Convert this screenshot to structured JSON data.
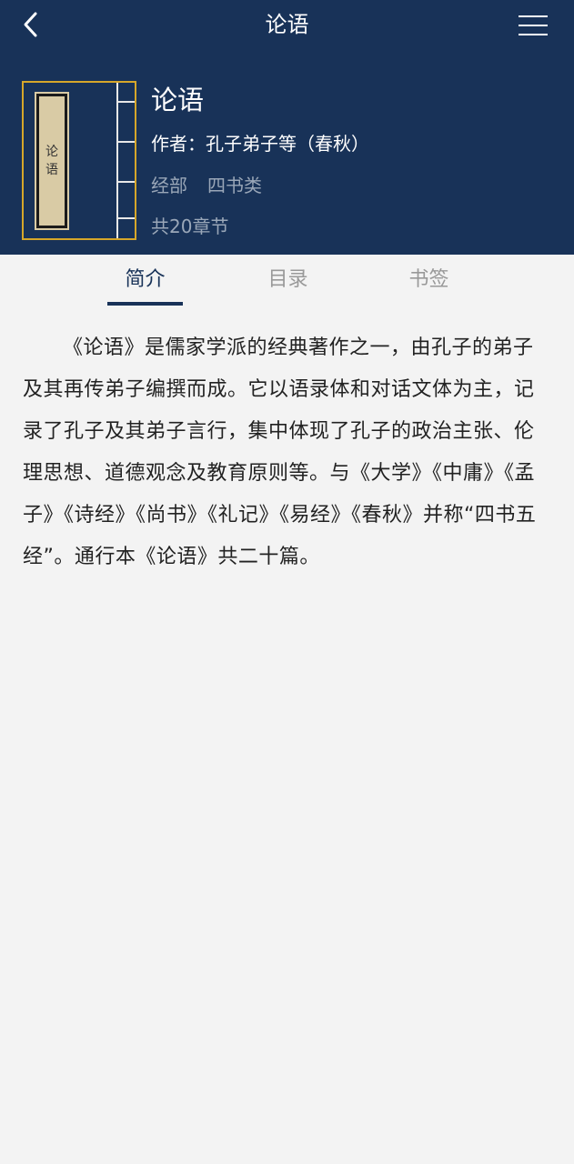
{
  "nav": {
    "title": "论语",
    "back_icon": "chevron-left-icon",
    "menu_icon": "hamburger-menu-icon"
  },
  "book": {
    "cover_chars": [
      "论",
      "语"
    ],
    "title": "论语",
    "author": "作者：孔子弟子等（春秋）",
    "category": "经部",
    "subcategory": "四书类",
    "chapters": "共20章节"
  },
  "tabs": [
    {
      "label": "简介",
      "active": true
    },
    {
      "label": "目录",
      "active": false
    },
    {
      "label": "书签",
      "active": false
    }
  ],
  "intro": "《论语》是儒家学派的经典著作之一，由孔子的弟子及其再传弟子编撰而成。它以语录体和对话文体为主，记录了孔子及其弟子言行，集中体现了孔子的政治主张、伦理思想、道德观念及教育原则等。与《大学》《中庸》《孟子》《诗经》《尚书》《礼记》《易经》《春秋》并称“四书五经”。通行本《论语》共二十篇。",
  "colors": {
    "header_bg": "#183258",
    "accent": "#183258",
    "cover_border": "#d6a72a",
    "page_bg": "#f3f3f3",
    "tab_inactive": "#999999"
  }
}
